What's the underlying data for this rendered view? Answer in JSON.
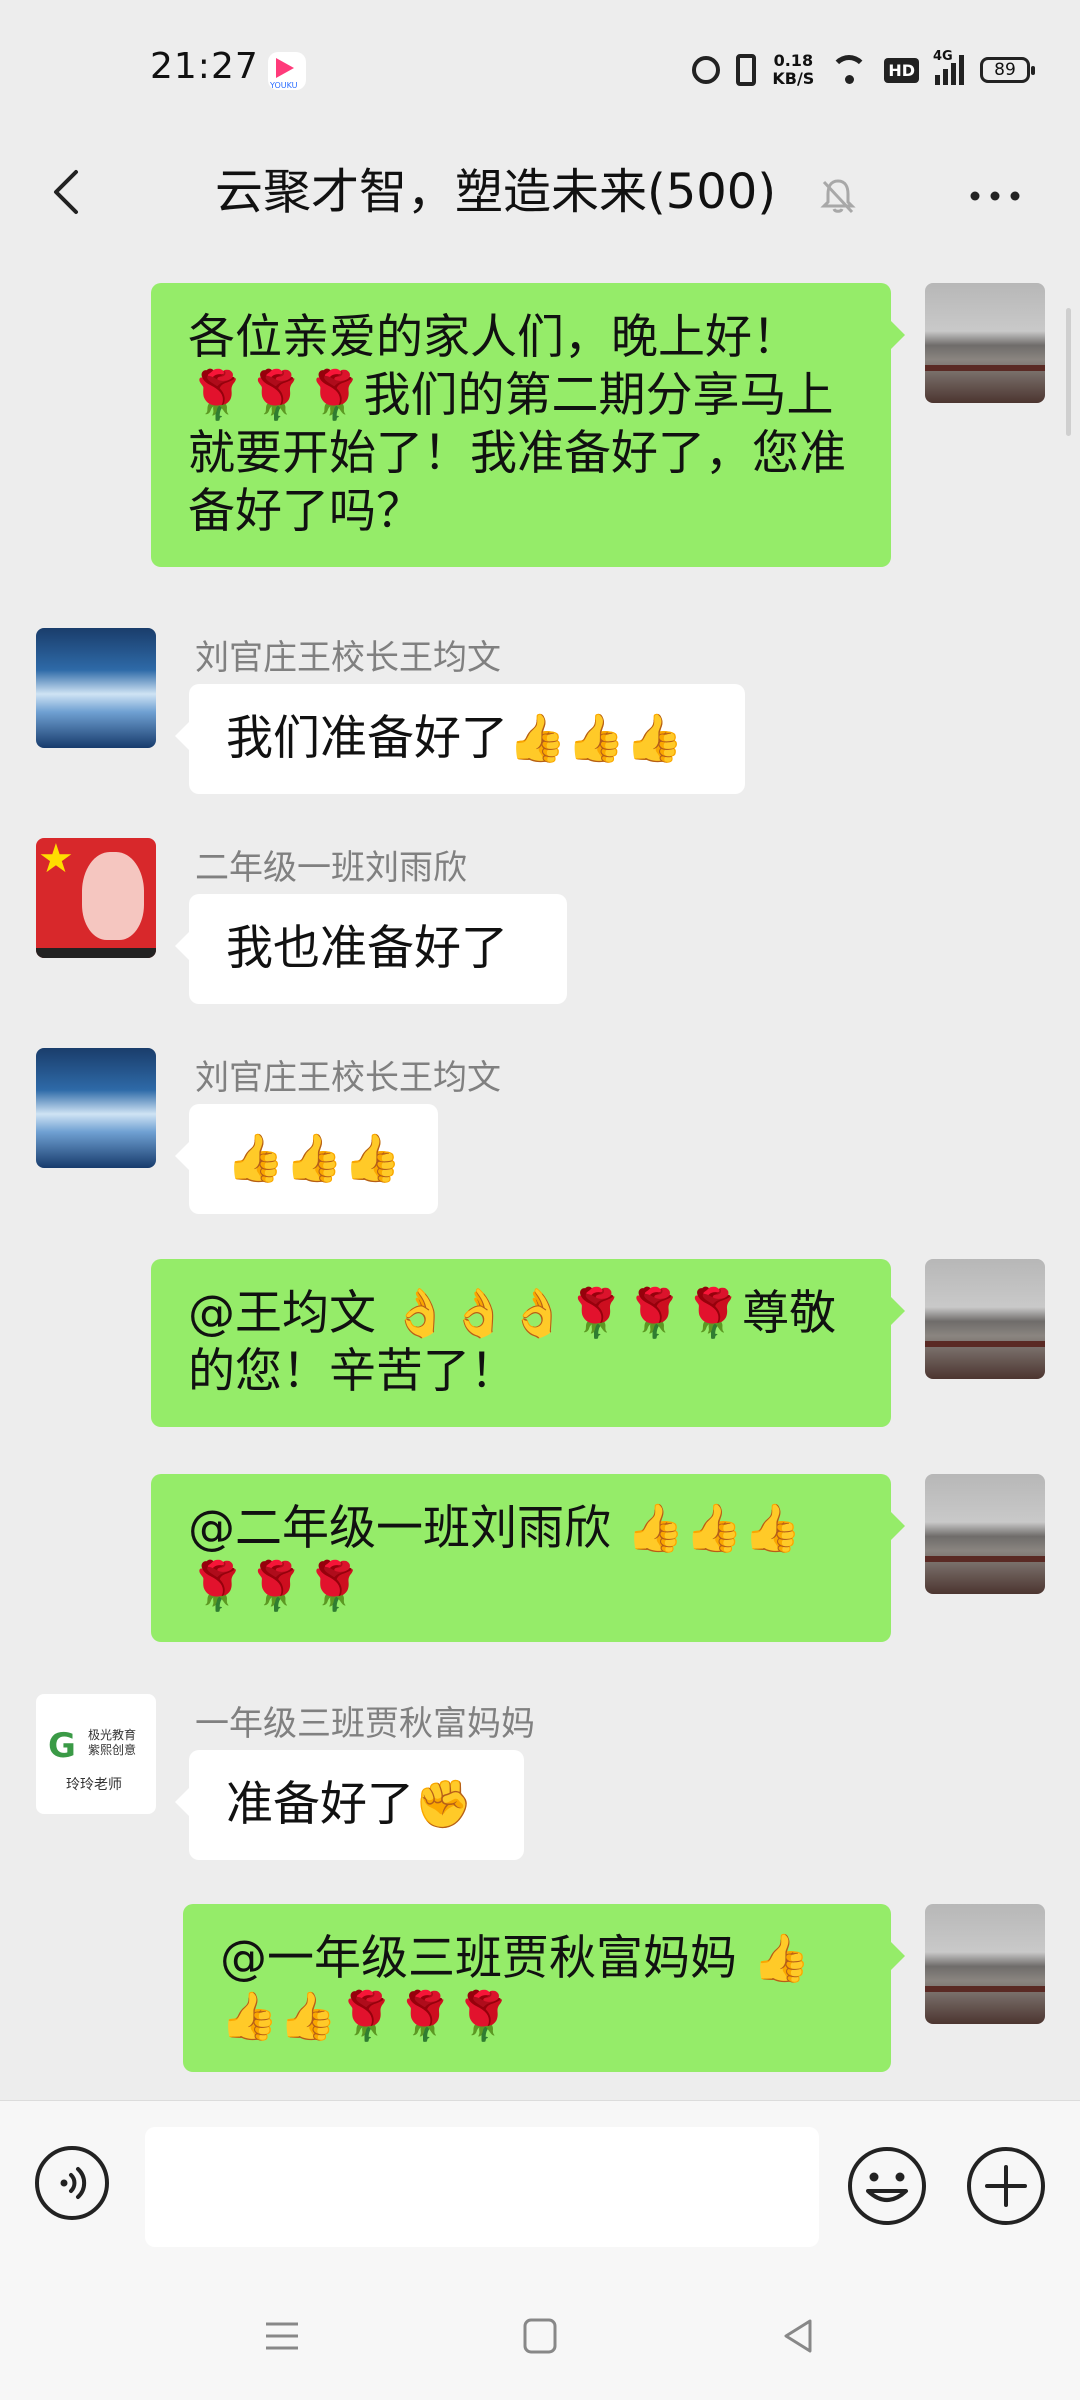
{
  "status_bar": {
    "time": "21:27",
    "app_label": "YOUKU",
    "net_speed_value": "0.18",
    "net_speed_unit": "KB/S",
    "hd_label": "HD",
    "network": "4G",
    "battery": "89"
  },
  "header": {
    "title": "云聚才智，塑造未来(500)"
  },
  "messages": [
    {
      "side": "self",
      "text": "各位亲爱的家人们，晚上好！🌹🌹🌹我们的第二期分享马上就要开始了！我准备好了，您准备好了吗？"
    },
    {
      "side": "other",
      "sender": "刘官庄王校长王均文",
      "text": "我们准备好了👍👍👍"
    },
    {
      "side": "other",
      "sender": "二年级一班刘雨欣",
      "text": "我也准备好了"
    },
    {
      "side": "other",
      "sender": "刘官庄王校长王均文",
      "text": "👍👍👍"
    },
    {
      "side": "self",
      "text": "@王均文 👌👌👌🌹🌹🌹尊敬的您！辛苦了！"
    },
    {
      "side": "self",
      "text": "@二年级一班刘雨欣 👍👍👍🌹🌹🌹"
    },
    {
      "side": "other",
      "sender": "一年级三班贾秋富妈妈",
      "text": "准备好了✊"
    },
    {
      "side": "self",
      "text": "@一年级三班贾秋富妈妈 👍👍👍🌹🌹🌹"
    }
  ],
  "avatars": {
    "logo_text_line1": "极光教育",
    "logo_text_line2": "紫熙创意",
    "logo_caption": "玲玲老师"
  },
  "input": {
    "value": "",
    "placeholder": ""
  },
  "colors": {
    "self_bubble": "#95ec69",
    "other_bubble": "#ffffff",
    "background": "#ededed"
  }
}
